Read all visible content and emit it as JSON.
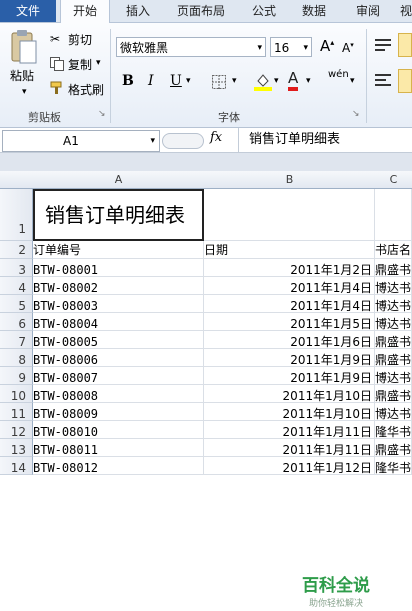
{
  "tabs": {
    "file": "文件",
    "home": "开始",
    "insert": "插入",
    "page_layout": "页面布局",
    "formulas": "公式",
    "data": "数据",
    "review": "审阅",
    "view_partial": "视"
  },
  "clipboard": {
    "paste": "粘贴",
    "cut": "剪切",
    "copy": "复制",
    "format_painter": "格式刷",
    "group_label": "剪贴板"
  },
  "font": {
    "name": "微软雅黑",
    "size": "16",
    "bold": "B",
    "italic": "I",
    "underline": "U",
    "grow": "A",
    "shrink": "A",
    "font_color": "A",
    "phonetic": "wén",
    "group_label": "字体"
  },
  "formula_bar": {
    "name_box": "A1",
    "fx": "fx",
    "content": "销售订单明细表"
  },
  "columns": [
    "A",
    "B",
    "C"
  ],
  "sheet": {
    "title": "销售订单明细表",
    "title_row": "1",
    "headers": {
      "row": "2",
      "a": "订单编号",
      "b": "日期",
      "c": "书店名称"
    },
    "rows": [
      {
        "n": "3",
        "a": "BTW-08001",
        "b": "2011年1月2日",
        "c": "鼎盛书店"
      },
      {
        "n": "4",
        "a": "BTW-08002",
        "b": "2011年1月4日",
        "c": "博达书店"
      },
      {
        "n": "5",
        "a": "BTW-08003",
        "b": "2011年1月4日",
        "c": "博达书店"
      },
      {
        "n": "6",
        "a": "BTW-08004",
        "b": "2011年1月5日",
        "c": "博达书店"
      },
      {
        "n": "7",
        "a": "BTW-08005",
        "b": "2011年1月6日",
        "c": "鼎盛书店"
      },
      {
        "n": "8",
        "a": "BTW-08006",
        "b": "2011年1月9日",
        "c": "鼎盛书店"
      },
      {
        "n": "9",
        "a": "BTW-08007",
        "b": "2011年1月9日",
        "c": "博达书店"
      },
      {
        "n": "10",
        "a": "BTW-08008",
        "b": "2011年1月10日",
        "c": "鼎盛书店"
      },
      {
        "n": "11",
        "a": "BTW-08009",
        "b": "2011年1月10日",
        "c": "博达书店"
      },
      {
        "n": "12",
        "a": "BTW-08010",
        "b": "2011年1月11日",
        "c": "隆华书店"
      },
      {
        "n": "13",
        "a": "BTW-08011",
        "b": "2011年1月11日",
        "c": "鼎盛书店"
      },
      {
        "n": "14",
        "a": "BTW-08012",
        "b": "2011年1月12日",
        "c": "隆华书店"
      }
    ]
  },
  "watermark": {
    "line1": "百科全说",
    "line2": "助你轻松解决"
  }
}
